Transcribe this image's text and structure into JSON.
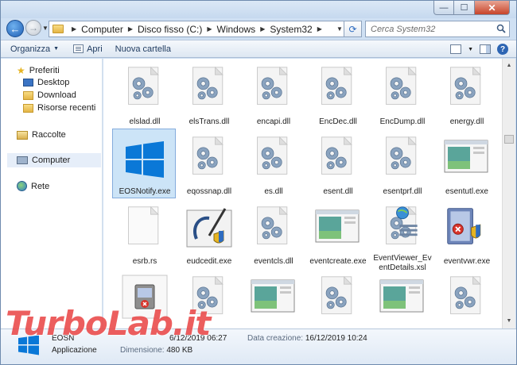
{
  "window": {
    "controls": {
      "minimize": "—",
      "maximize": "☐",
      "close": "✕"
    }
  },
  "nav": {
    "back": "←",
    "forward": "→"
  },
  "address": {
    "crumbs": [
      "Computer",
      "Disco fisso (C:)",
      "Windows",
      "System32"
    ],
    "refresh": "⟳"
  },
  "search": {
    "placeholder": "Cerca System32"
  },
  "toolbar": {
    "organize": "Organizza",
    "open": "Apri",
    "new_folder": "Nuova cartella",
    "help": "?"
  },
  "navpane": {
    "favorites": "Preferiti",
    "desktop": "Desktop",
    "download": "Download",
    "recent": "Risorse recenti",
    "libraries": "Raccolte",
    "computer": "Computer",
    "network": "Rete"
  },
  "files": [
    {
      "name": "elslad.dll",
      "type": "dll"
    },
    {
      "name": "elsTrans.dll",
      "type": "dll"
    },
    {
      "name": "encapi.dll",
      "type": "dll"
    },
    {
      "name": "EncDec.dll",
      "type": "dll"
    },
    {
      "name": "EncDump.dll",
      "type": "dll"
    },
    {
      "name": "energy.dll",
      "type": "dll"
    },
    {
      "name": "EOSNotify.exe",
      "type": "win-exe",
      "selected": true
    },
    {
      "name": "eqossnap.dll",
      "type": "dll"
    },
    {
      "name": "es.dll",
      "type": "dll"
    },
    {
      "name": "esent.dll",
      "type": "dll"
    },
    {
      "name": "esentprf.dll",
      "type": "dll"
    },
    {
      "name": "esentutl.exe",
      "type": "window-exe"
    },
    {
      "name": "esrb.rs",
      "type": "blank"
    },
    {
      "name": "eudcedit.exe",
      "type": "eudc"
    },
    {
      "name": "eventcls.dll",
      "type": "dll"
    },
    {
      "name": "eventcreate.exe",
      "type": "window-exe"
    },
    {
      "name": "EventViewer_EventDetails.xsl",
      "label_lines": [
        "EventViewer_Ev",
        "entDetails.xsl"
      ],
      "type": "xsl"
    },
    {
      "name": "eventvwr.exe",
      "type": "eventvwr"
    },
    {
      "name": "",
      "type": "shield-exe"
    },
    {
      "name": "",
      "type": "dll"
    },
    {
      "name": "",
      "type": "window-exe"
    },
    {
      "name": "",
      "type": "dll"
    },
    {
      "name": "",
      "type": "window-exe"
    },
    {
      "name": "",
      "type": "dll"
    }
  ],
  "details": {
    "name": "EOSN",
    "type_label": "Applicazione",
    "modified_value": "6/12/2019 06:27",
    "size_label": "Dimensione:",
    "size_value": "480 KB",
    "created_label": "Data creazione:",
    "created_value": "16/12/2019 10:24"
  },
  "watermark": "TurboLab.it",
  "colors": {
    "selection": "#cce4f7",
    "selection_border": "#84acdd",
    "watermark": "#e62828",
    "windows_blue": "#0a78d7"
  }
}
